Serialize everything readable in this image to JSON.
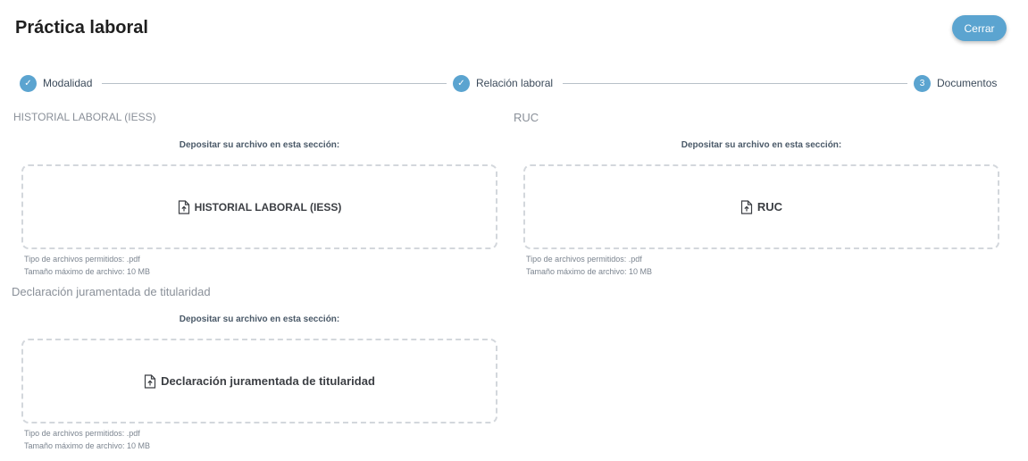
{
  "header": {
    "title": "Práctica laboral",
    "close_label": "Cerrar"
  },
  "stepper": {
    "steps": [
      {
        "label": "Modalidad",
        "marker": "✓",
        "icon": "check-icon",
        "status": "done"
      },
      {
        "label": "Relación laboral",
        "marker": "✓",
        "icon": "check-icon",
        "status": "done"
      },
      {
        "label": "Documentos",
        "marker": "3",
        "status": "current"
      }
    ]
  },
  "colors": {
    "accent": "#5ba4d0",
    "dropzone_border": "#d3d7dc"
  },
  "uploads": [
    {
      "section_title": "HISTORIAL LABORAL (IESS)",
      "deposit_label": "Depositar su archivo en esta sección:",
      "drop_label": "HISTORIAL LABORAL (IESS)",
      "icon": "file-upload-icon",
      "allowed_types": "Tipo de archivos permitidos: .pdf",
      "max_size": "Tamaño máximo de archivo: 10 MB"
    },
    {
      "section_title": "RUC",
      "deposit_label": "Depositar su archivo en esta sección:",
      "drop_label": "RUC",
      "icon": "file-upload-icon",
      "allowed_types": "Tipo de archivos permitidos: .pdf",
      "max_size": "Tamaño máximo de archivo: 10 MB"
    },
    {
      "section_title": "Declaración juramentada de titularidad",
      "deposit_label": "Depositar su archivo en esta sección:",
      "drop_label": "Declaración juramentada de titularidad",
      "icon": "file-upload-icon",
      "allowed_types": "Tipo de archivos permitidos: .pdf",
      "max_size": "Tamaño máximo de archivo: 10 MB"
    }
  ]
}
